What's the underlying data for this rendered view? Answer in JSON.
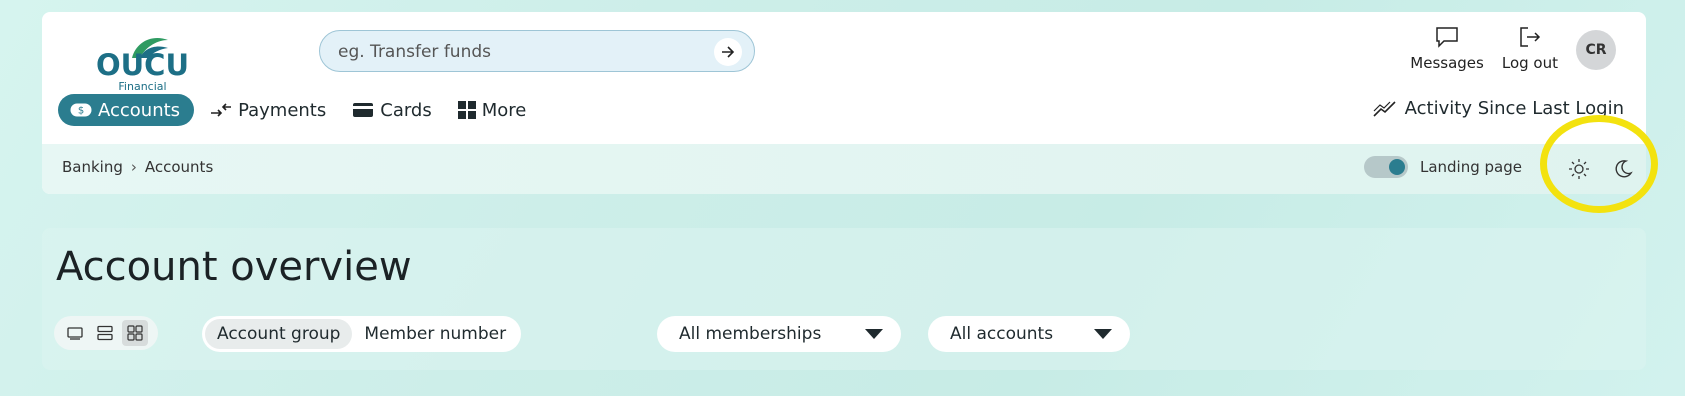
{
  "brand": {
    "name": "OUCU",
    "sub": "Financial",
    "color": "#1d6f86"
  },
  "search": {
    "placeholder": "eg. Transfer funds"
  },
  "header_actions": {
    "messages": "Messages",
    "logout": "Log out",
    "avatar": "CR"
  },
  "nav": {
    "items": [
      {
        "label": "Accounts",
        "icon": "dollar-badge-icon",
        "active": true
      },
      {
        "label": "Payments",
        "icon": "transfer-arrows-icon",
        "active": false
      },
      {
        "label": "Cards",
        "icon": "card-icon",
        "active": false
      },
      {
        "label": "More",
        "icon": "grid-icon",
        "active": false
      }
    ],
    "activity": "Activity Since Last Login"
  },
  "breadcrumb": {
    "root": "Banking",
    "current": "Accounts"
  },
  "landing_toggle": {
    "label": "Landing page",
    "on": true
  },
  "theme": {
    "light_icon": "sun-icon",
    "dark_icon": "moon-icon",
    "highlight_color": "#f3e20f"
  },
  "main": {
    "title": "Account overview",
    "group_by": [
      "Account group",
      "Member number"
    ],
    "memberships_dropdown": "All memberships",
    "accounts_dropdown": "All accounts"
  },
  "colors": {
    "accent": "#2b7d8f"
  }
}
